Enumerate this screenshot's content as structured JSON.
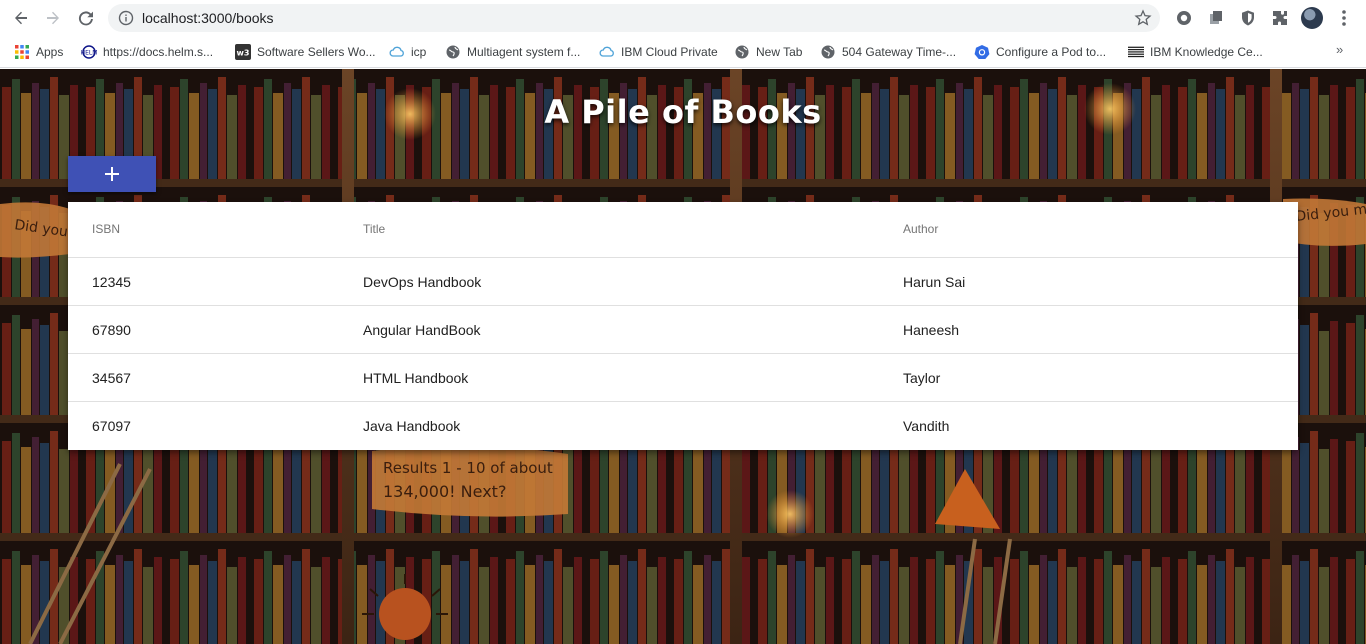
{
  "browser": {
    "url": "localhost:3000/books",
    "nav": {
      "back": "back-arrow-icon",
      "forward": "forward-arrow-icon",
      "reload": "reload-icon"
    },
    "bookmarks": [
      {
        "label": "Apps",
        "icon": "apps-grid-icon"
      },
      {
        "label": "https://docs.helm.s...",
        "icon": "helm-icon"
      },
      {
        "label": "Software Sellers Wo...",
        "icon": "w3-icon"
      },
      {
        "label": "icp",
        "icon": "cloud-icon"
      },
      {
        "label": "Multiagent system f...",
        "icon": "globe-icon"
      },
      {
        "label": "IBM Cloud Private",
        "icon": "cloud-icon"
      },
      {
        "label": "New Tab",
        "icon": "globe-icon"
      },
      {
        "label": "504 Gateway Time-...",
        "icon": "globe-icon"
      },
      {
        "label": "Configure a Pod to...",
        "icon": "kubernetes-icon"
      },
      {
        "label": "IBM Knowledge Ce...",
        "icon": "ibm-icon"
      }
    ],
    "more": "»"
  },
  "page": {
    "title": "A Pile of Books",
    "add_button": "+",
    "accent": "#3f51b5",
    "columns": [
      "ISBN",
      "Title",
      "Author"
    ],
    "rows": [
      {
        "isbn": "12345",
        "title": "DevOps Handbook",
        "author": "Harun Sai"
      },
      {
        "isbn": "67890",
        "title": "Angular HandBook",
        "author": "Haneesh"
      },
      {
        "isbn": "34567",
        "title": "HTML Handbook",
        "author": "Taylor"
      },
      {
        "isbn": "67097",
        "title": "Java Handbook",
        "author": "Vandith"
      }
    ]
  }
}
